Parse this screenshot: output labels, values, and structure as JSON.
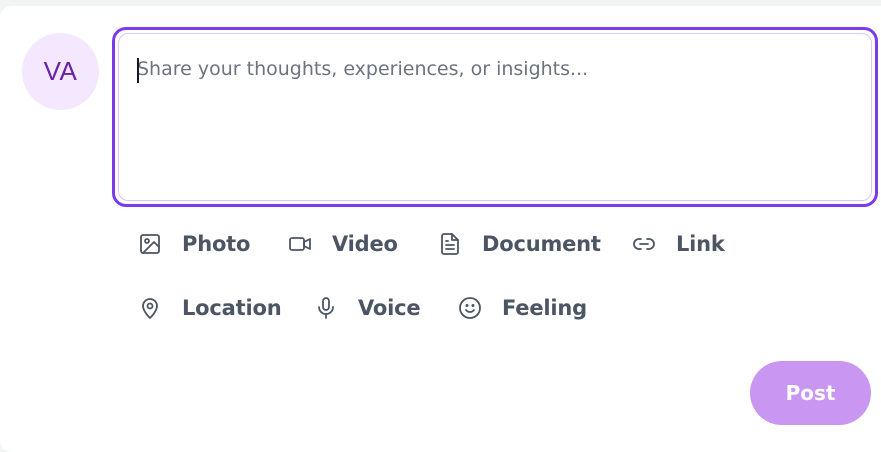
{
  "composer": {
    "avatar_initials": "VA",
    "placeholder": "Share your thoughts, experiences, or insights...",
    "value": ""
  },
  "actions": {
    "row1": [
      {
        "label": "Photo",
        "icon": "image-icon"
      },
      {
        "label": "Video",
        "icon": "video-icon"
      },
      {
        "label": "Document",
        "icon": "document-icon"
      },
      {
        "label": "Link",
        "icon": "link-icon"
      }
    ],
    "row2": [
      {
        "label": "Location",
        "icon": "map-pin-icon"
      },
      {
        "label": "Voice",
        "icon": "microphone-icon"
      },
      {
        "label": "Feeling",
        "icon": "smiley-icon"
      }
    ]
  },
  "post_button": {
    "label": "Post"
  },
  "colors": {
    "accent": "#7c3aed",
    "avatar_bg": "#f3e8ff",
    "avatar_text": "#6b21a8",
    "post_button_bg": "#c997f2",
    "action_text": "#4b5563"
  }
}
